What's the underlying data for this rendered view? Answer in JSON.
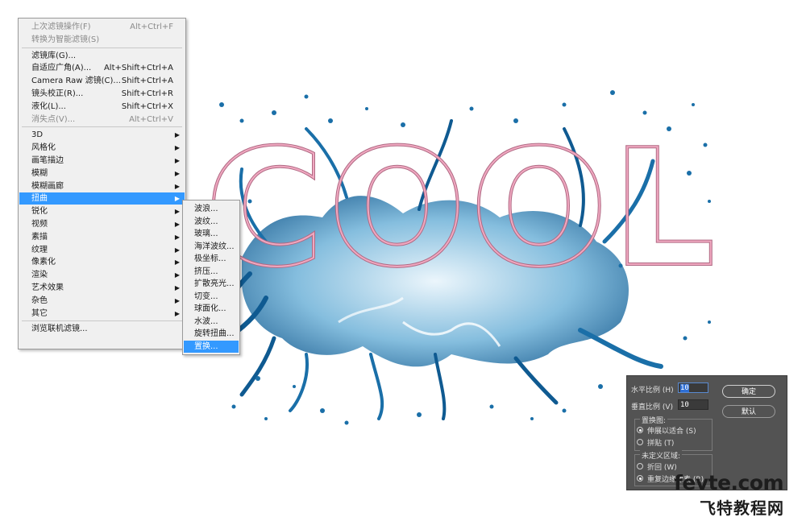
{
  "filter_menu": {
    "items": [
      {
        "label": "上次滤镜操作(F)",
        "shortcut": "Alt+Ctrl+F",
        "disabled": true
      },
      {
        "label": "转换为智能滤镜(S)",
        "shortcut": "",
        "disabled": true
      },
      {
        "label": "滤镜库(G)...",
        "shortcut": ""
      },
      {
        "label": "自适应广角(A)...",
        "shortcut": "Alt+Shift+Ctrl+A"
      },
      {
        "label": "Camera Raw 滤镜(C)...",
        "shortcut": "Shift+Ctrl+A"
      },
      {
        "label": "镜头校正(R)...",
        "shortcut": "Shift+Ctrl+R"
      },
      {
        "label": "液化(L)...",
        "shortcut": "Shift+Ctrl+X"
      },
      {
        "label": "消失点(V)...",
        "shortcut": "Alt+Ctrl+V",
        "disabled": true
      },
      {
        "label": "3D",
        "submenu": true
      },
      {
        "label": "风格化",
        "submenu": true
      },
      {
        "label": "画笔描边",
        "submenu": true
      },
      {
        "label": "模糊",
        "submenu": true
      },
      {
        "label": "模糊画廊",
        "submenu": true
      },
      {
        "label": "扭曲",
        "submenu": true,
        "highlighted": true
      },
      {
        "label": "锐化",
        "submenu": true
      },
      {
        "label": "视频",
        "submenu": true
      },
      {
        "label": "素描",
        "submenu": true
      },
      {
        "label": "纹理",
        "submenu": true
      },
      {
        "label": "像素化",
        "submenu": true
      },
      {
        "label": "渲染",
        "submenu": true
      },
      {
        "label": "艺术效果",
        "submenu": true
      },
      {
        "label": "杂色",
        "submenu": true
      },
      {
        "label": "其它",
        "submenu": true
      },
      {
        "label": "浏览联机滤镜...",
        "shortcut": ""
      }
    ]
  },
  "distort_submenu": {
    "items": [
      {
        "label": "波浪..."
      },
      {
        "label": "波纹..."
      },
      {
        "label": "玻璃..."
      },
      {
        "label": "海洋波纹..."
      },
      {
        "label": "极坐标..."
      },
      {
        "label": "挤压..."
      },
      {
        "label": "扩散亮光..."
      },
      {
        "label": "切变..."
      },
      {
        "label": "球面化..."
      },
      {
        "label": "水波..."
      },
      {
        "label": "旋转扭曲..."
      },
      {
        "label": "置换...",
        "highlighted": true
      }
    ]
  },
  "displace_dialog": {
    "horizontal_label": "水平比例 (H)",
    "horizontal_value": "10",
    "vertical_label": "垂直比例 (V)",
    "vertical_value": "10",
    "ok_label": "确定",
    "default_label": "默认",
    "map_group_label": "置换图:",
    "stretch_label": "伸展以适合 (S)",
    "stretch_selected": true,
    "tile_label": "拼贴 (T)",
    "undefined_group_label": "未定义区域:",
    "wrap_label": "折回 (W)",
    "repeat_label": "重复边缘像素 (R)",
    "repeat_selected": true
  },
  "artwork": {
    "text": "COOL",
    "text_color": "#f0a8c0",
    "water_color": "#1a6fa8"
  },
  "watermark": {
    "line1": "fevte.com",
    "line2": "飞特教程网"
  },
  "colors": {
    "menu_highlight": "#3399ff",
    "dialog_bg": "#535353"
  }
}
